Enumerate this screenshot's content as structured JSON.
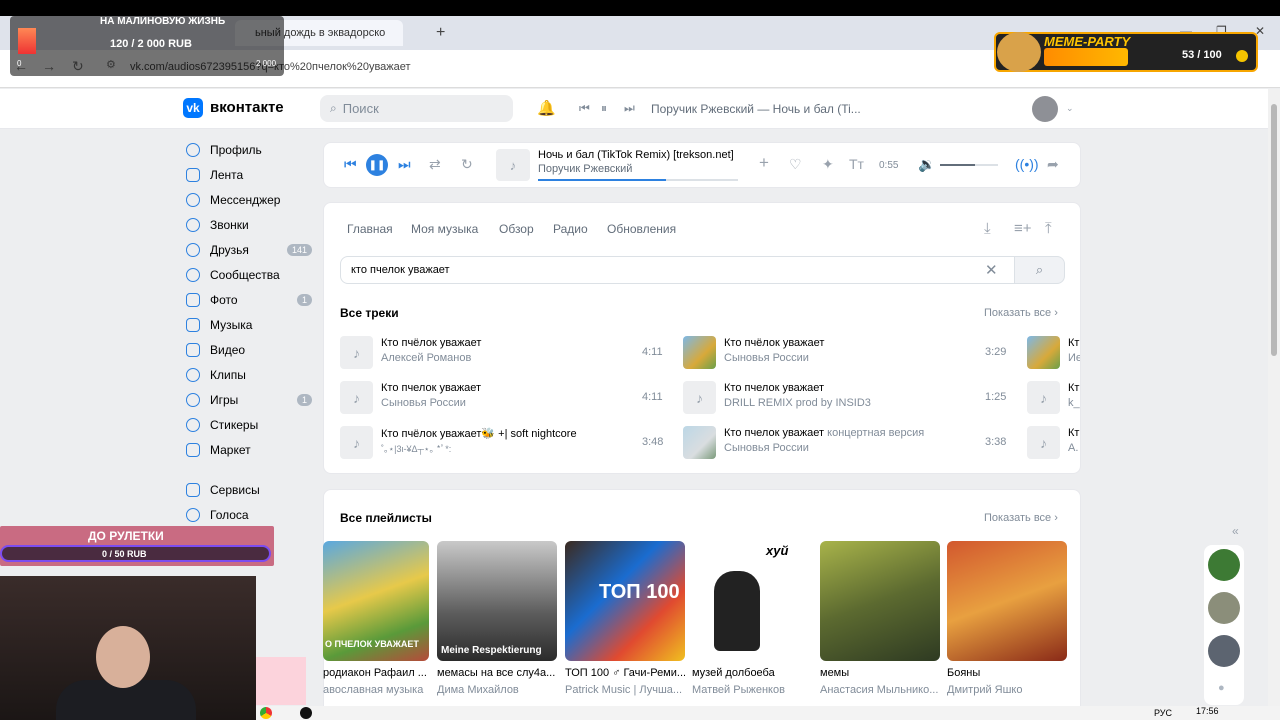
{
  "overlays": {
    "donation_title": "НА МАЛИНОВУЮ ЖИЗНЬ",
    "donation_amount": "120 / 2 000 RUB",
    "donation_min": "0",
    "donation_max": "2 000",
    "meme_label": "MEME-PARTY",
    "meme_count": "53 / 100",
    "roulette_title": "ДО РУЛЕТКИ",
    "roulette_amount": "0 / 50 RUB"
  },
  "browser": {
    "tab2_title": "ьный дождь в эквадорско",
    "new_tab": "+",
    "url": "vk.com/audios672395156?q=кто%20пчелок%20уважает",
    "window_min": "—",
    "window_max": "❐",
    "window_close": "✕"
  },
  "header": {
    "logo_letter": "vk",
    "site_name": "вконтакте",
    "search_placeholder": "Поиск",
    "now_playing": "Поручик Ржевский — Ночь и бал (Ti..."
  },
  "sidebar": {
    "items": [
      {
        "label": "Профиль",
        "badge": ""
      },
      {
        "label": "Лента",
        "badge": ""
      },
      {
        "label": "Мессенджер",
        "badge": ""
      },
      {
        "label": "Звонки",
        "badge": ""
      },
      {
        "label": "Друзья",
        "badge": "141"
      },
      {
        "label": "Сообщества",
        "badge": ""
      },
      {
        "label": "Фото",
        "badge": "1"
      },
      {
        "label": "Музыка",
        "badge": ""
      },
      {
        "label": "Видео",
        "badge": ""
      },
      {
        "label": "Клипы",
        "badge": ""
      },
      {
        "label": "Игры",
        "badge": "1"
      },
      {
        "label": "Стикеры",
        "badge": ""
      },
      {
        "label": "Маркет",
        "badge": ""
      },
      {
        "label": "Сервисы",
        "badge": ""
      },
      {
        "label": "Голоса",
        "badge": ""
      }
    ]
  },
  "player": {
    "title": "Ночь и бал (TikTok Remix) [trekson.net]",
    "artist": "Поручик Ржевский",
    "time": "0:55",
    "progress": 0.64,
    "volume": 0.6
  },
  "music": {
    "tabs": [
      "Главная",
      "Моя музыка",
      "Обзор",
      "Радио",
      "Обновления"
    ],
    "query": "кто пчелок уважает",
    "tracks_title": "Все треки",
    "show_all": "Показать все",
    "tracks": [
      {
        "title": "Кто пчёлок уважает",
        "suffix": "",
        "artist": "Алексей Романов",
        "duration": "4:11"
      },
      {
        "title": "Кто пчелок уважает",
        "suffix": "",
        "artist": "Сыновья России",
        "duration": "4:11"
      },
      {
        "title": "Кто пчёлок уважает🐝 +| soft nightcore",
        "suffix": "",
        "artist": "˚｡⋆|3ι-¥Δ┬⋆｡ *ﾟ*:",
        "duration": "3:48"
      },
      {
        "title": "Кто пчёлок уважает",
        "suffix": "",
        "artist": "Сыновья России",
        "duration": "3:29"
      },
      {
        "title": "Кто пчелок уважает",
        "suffix": "",
        "artist": "DRILL REMIX prod by INSID3",
        "duration": "1:25"
      },
      {
        "title": "Кто пчелок уважает",
        "suffix": " концертная версия",
        "artist": "Сыновья России",
        "duration": "3:38"
      }
    ],
    "col3": [
      {
        "title": "Кт",
        "artist": "Ие"
      },
      {
        "title": "Кт",
        "artist": "k_i"
      },
      {
        "title": "Кт",
        "artist": "А."
      }
    ],
    "playlists_title": "Все плейлисты",
    "playlists": [
      {
        "title": "родиакон Рафаил ...",
        "sub": "авославная музыка",
        "cover_text": "О ПЧЕЛОК УВАЖАЕТ"
      },
      {
        "title": "мемасы на все слу4а...",
        "sub": "Дима Михайлов",
        "cover_text": "Meine Respektierung"
      },
      {
        "title": "ТОП 100 ♂ Гачи-Реми...",
        "sub": "Patrick Music | Лучша...",
        "cover_text": "ТОП 100"
      },
      {
        "title": "музей долбоеба",
        "sub": "Матвей Рыженков",
        "cover_text": "хуй"
      },
      {
        "title": "мемы",
        "sub": "Анастасия Мыльнико...",
        "cover_text": ""
      },
      {
        "title": "Бояны",
        "sub": "Дмитрий Яшко",
        "cover_text": ""
      }
    ]
  },
  "taskbar": {
    "time": "17:56",
    "lang": "РУС"
  }
}
